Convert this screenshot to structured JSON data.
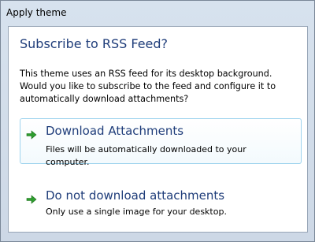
{
  "window": {
    "title": "Apply theme"
  },
  "dialog": {
    "heading": "Subscribe to RSS Feed?",
    "description_lines": [
      "This theme uses an RSS feed for its desktop background.",
      "Would you like to subscribe to the feed and configure it to",
      "automatically download attachments?"
    ],
    "options": [
      {
        "title": "Download Attachments",
        "subtitle_lines": [
          "Files will be automatically downloaded to your",
          "computer."
        ]
      },
      {
        "title": "Do not download attachments",
        "subtitle_lines": [
          "Only use a single image for your desktop."
        ]
      }
    ]
  },
  "icons": {
    "option_arrow": "green-right-arrow-icon"
  },
  "colors": {
    "heading": "#1f3d7a",
    "arrow": "#2e9e2e",
    "selected_border": "#9fd4ee"
  }
}
